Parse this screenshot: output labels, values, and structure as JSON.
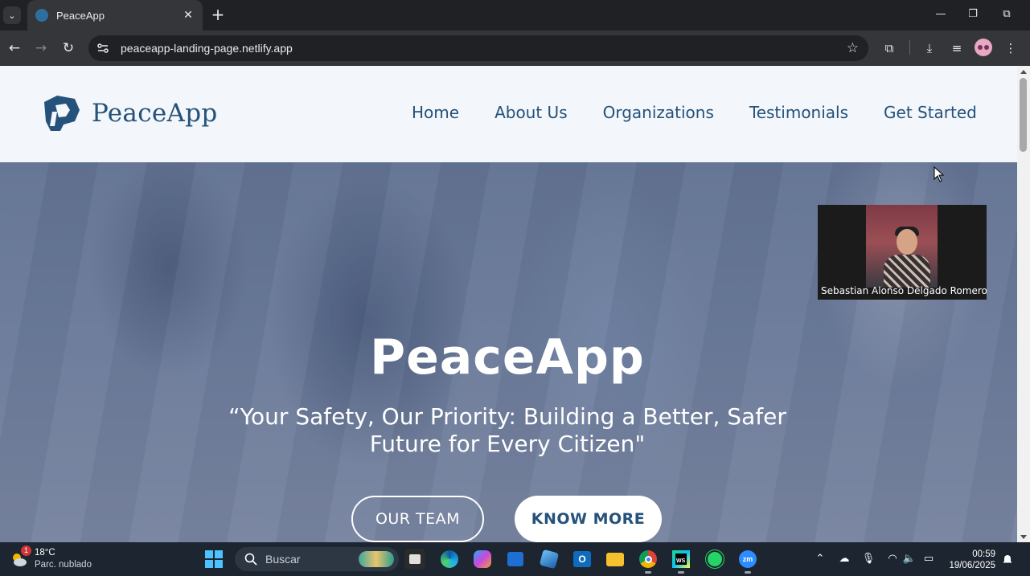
{
  "browser": {
    "tab_title": "PeaceApp",
    "url": "peaceapp-landing-page.netlify.app"
  },
  "site": {
    "logo_text": "PeaceApp",
    "nav": [
      {
        "label": "Home"
      },
      {
        "label": "About Us"
      },
      {
        "label": "Organizations"
      },
      {
        "label": "Testimonials"
      },
      {
        "label": "Get Started"
      }
    ],
    "hero": {
      "title": "PeaceApp",
      "quote": "“Your Safety, Our Priority: Building a Better, Safer Future for Every Citizen\"",
      "buttons": [
        {
          "label": "OUR TEAM"
        },
        {
          "label": "KNOW MORE"
        }
      ]
    }
  },
  "video_call": {
    "participant_name": "Sebastian Alonso Delgado Romero"
  },
  "taskbar": {
    "weather": {
      "temperature": "18°C",
      "condition": "Parc. nublado",
      "badge": "1"
    },
    "search_placeholder": "Buscar",
    "time": "00:59",
    "date": "19/06/2025"
  },
  "colors": {
    "brand": "#24527a",
    "chrome_dark": "#202124",
    "chrome_toolbar": "#35363a",
    "taskbar": "#1c2530"
  }
}
